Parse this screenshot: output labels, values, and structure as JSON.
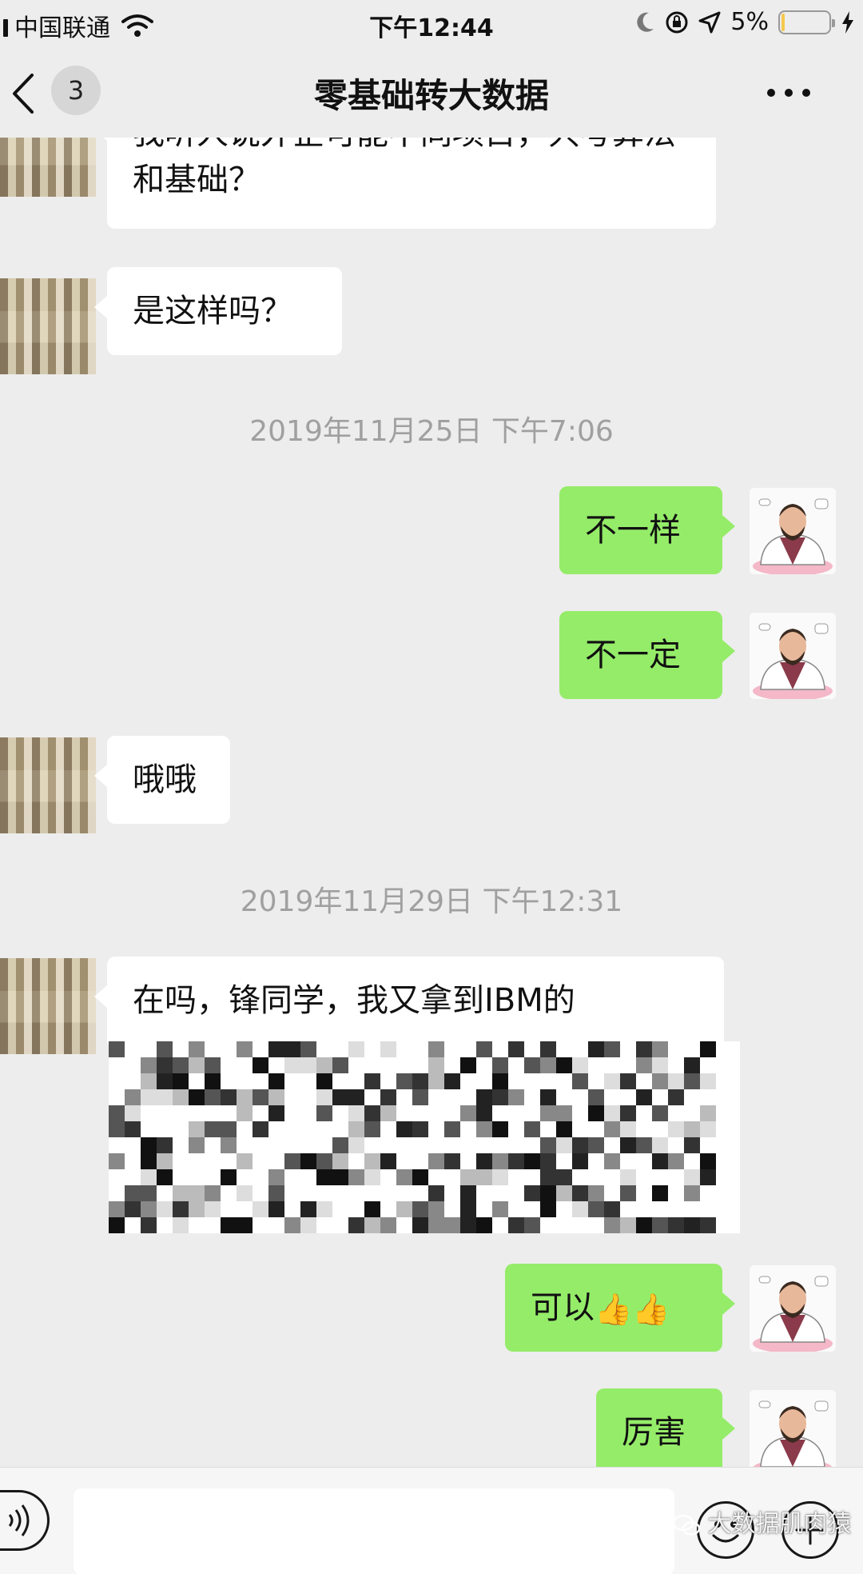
{
  "status_bar": {
    "carrier": "中国联通",
    "time": "下午12:44",
    "battery": "5%",
    "battery_level": 0.05
  },
  "nav": {
    "unread_count": "3",
    "title": "零基础转大数据"
  },
  "messages": {
    "m1": "我听人说外企可能不同项目，只考算法和基础？",
    "m2": "是这样吗？",
    "ts1": "2019年11月25日 下午7:06",
    "m3": "不一样",
    "m4": "不一定",
    "m5": "哦哦",
    "ts2": "2019年11月29日 下午12:31",
    "m6_visible": "在吗，锋同学，我又拿到IBM的",
    "m7": "可以",
    "m7_emoji": "👍👍",
    "m8": "厉害"
  },
  "watermark": "大数据肌肉猿",
  "icons": {
    "back": "chevron-left-icon",
    "more": "ellipsis-icon",
    "voice": "voice-icon",
    "emoji": "emoji-icon",
    "plus": "plus-icon"
  },
  "colors": {
    "background": "#ededed",
    "own_bubble": "#95ec69",
    "other_bubble": "#ffffff",
    "timestamp": "#a0a0a0"
  }
}
